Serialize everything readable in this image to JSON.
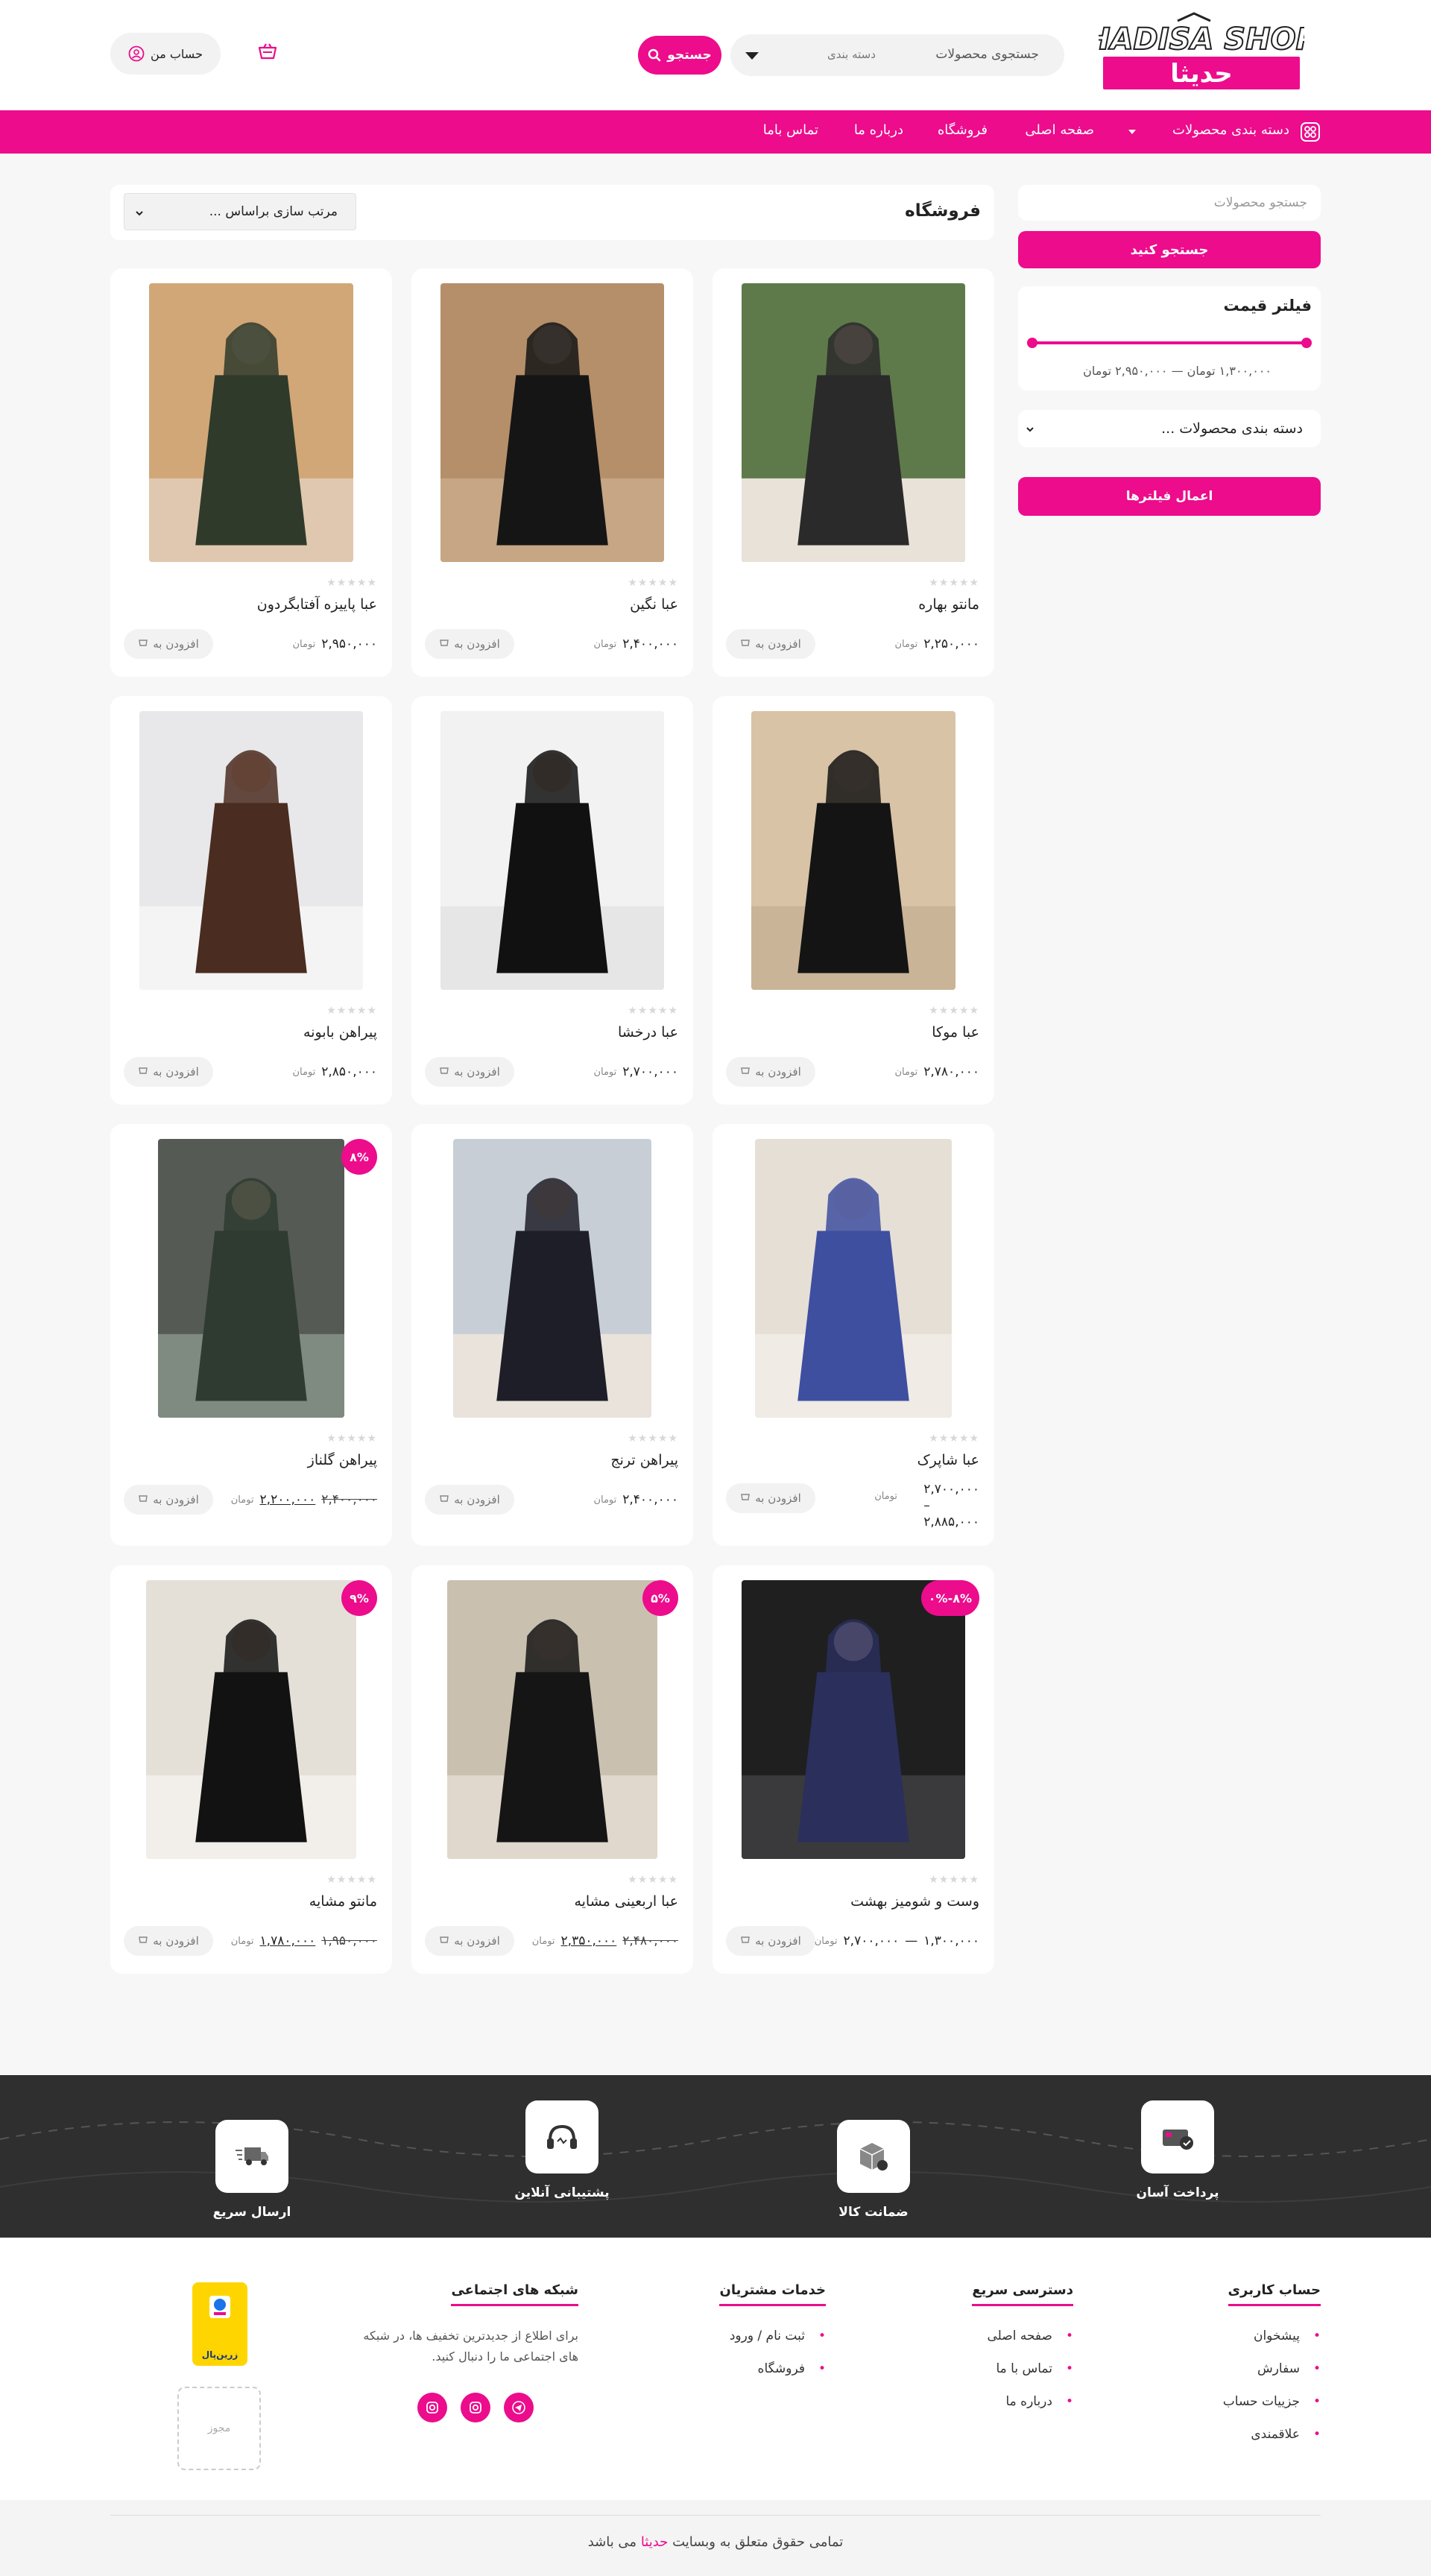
{
  "header": {
    "logo_en": "HADISA SHOP",
    "logo_fa": "حدیثا",
    "search_placeholder": "جستجوی محصولات",
    "category_select": "دسته بندی",
    "search_button": "جستجو",
    "account": "حساب من"
  },
  "nav": {
    "categories": "دسته بندی محصولات",
    "items": [
      "صفحه اصلی",
      "فروشگاه",
      "درباره ما",
      "تماس باما"
    ]
  },
  "sidebar": {
    "search_placeholder": "جستجو محصولات",
    "search_button": "جستجو کنید",
    "price_filter_title": "فیلتر قیمت",
    "price_range_text": "۱,۳۰۰,۰۰۰ تومان — ۲,۹۵۰,۰۰۰ تومان",
    "category_dropdown": "دسته بندی محصولات ...",
    "apply_filters": "اعمال فیلترها"
  },
  "shop": {
    "title": "فروشگاه",
    "sort_select": "مرتب سازی براساس ...",
    "currency": "تومان",
    "add_to_cart": "افزودن به",
    "stars": "★★★★★",
    "products": [
      {
        "title": "مانتو بهاره",
        "price": "۲,۲۵۰,۰۰۰"
      },
      {
        "title": "عبا نگین",
        "price": "۲,۴۰۰,۰۰۰"
      },
      {
        "title": "عبا پاییزه آفتابگردون",
        "price": "۲,۹۵۰,۰۰۰"
      },
      {
        "title": "عبا موکا",
        "price": "۲,۷۸۰,۰۰۰"
      },
      {
        "title": "عبا درخشا",
        "price": "۲,۷۰۰,۰۰۰"
      },
      {
        "title": "پیراهن بابونه",
        "price": "۲,۸۵۰,۰۰۰"
      },
      {
        "title": "عبا شاپرک",
        "price_from": "۲,۷۰۰,۰۰۰",
        "dash": "–",
        "price_to": "۲,۸۸۵,۰۰۰"
      },
      {
        "title": "پیراهن ترنج",
        "price": "۲,۴۰۰,۰۰۰"
      },
      {
        "title": "پیراهن گلناز",
        "badge": "۸%",
        "old_price": "۲,۴۰۰,۰۰۰",
        "price": "۲,۲۰۰,۰۰۰"
      },
      {
        "title": "وست و شومیز بهشت",
        "badge": "۸%-۰%",
        "price_from": "۱,۳۰۰,۰۰۰",
        "dash": "—",
        "price_to": "۲,۷۰۰,۰۰۰"
      },
      {
        "title": "عبا اربعینی مشایه",
        "badge": "۵%",
        "old_price": "۲,۴۸۰,۰۰۰",
        "price": "۲,۳۵۰,۰۰۰"
      },
      {
        "title": "مانتو مشایه",
        "badge": "۹%",
        "old_price": "۱,۹۵۰,۰۰۰",
        "price": "۱,۷۸۰,۰۰۰"
      }
    ]
  },
  "features": [
    {
      "label": "پرداخت آسان",
      "icon": "easy-payment-icon"
    },
    {
      "label": "ضمانت کالا",
      "icon": "product-guarantee-icon"
    },
    {
      "label": "پشتیبانی آنلاین",
      "icon": "online-support-icon"
    },
    {
      "label": "ارسال سریع",
      "icon": "fast-delivery-icon"
    }
  ],
  "footer": {
    "account_title": "حساب کاربری",
    "account_links": [
      "پیشخوان",
      "سفارش",
      "جزییات حساب",
      "علاقمندی"
    ],
    "quick_title": "دسترسی سریع",
    "quick_links": [
      "صفحه اصلی",
      "تماس با ما",
      "درباره ما"
    ],
    "service_title": "خدمات مشتریان",
    "service_links": [
      "ثبت نام / ورود",
      "فروشگاه"
    ],
    "social_title": "شبکه های اجتماعی",
    "social_text": "برای اطلاع از جدیدترین تخفیف ها، در شبکه های اجتماعی ما را دنبال کنید.",
    "zarinpal_label": "زرین‌پال",
    "license_label": "مجوز",
    "copyright_prefix": "تمامی حقوق متعلق به وبسایت",
    "copyright_brand": "حدیثا",
    "copyright_suffix": "می باشد"
  },
  "colors": {
    "accent": "#ec0c8c",
    "dark": "#2f2f2f"
  }
}
